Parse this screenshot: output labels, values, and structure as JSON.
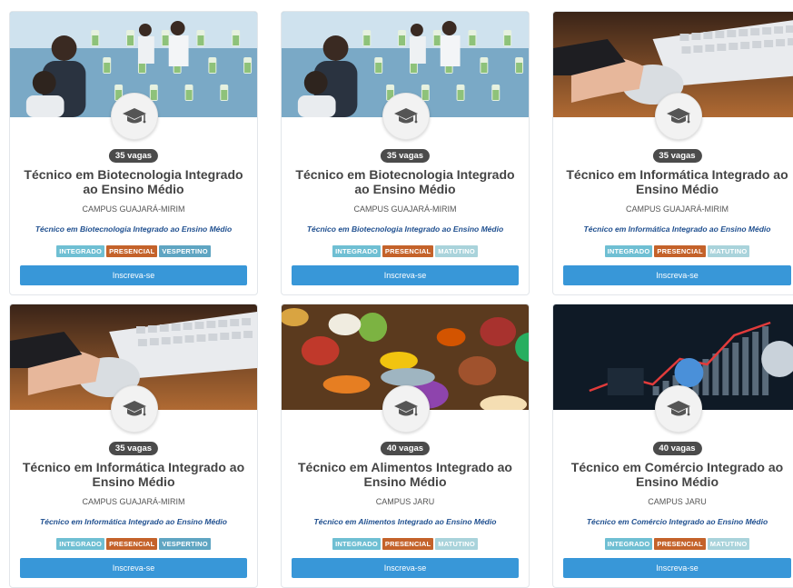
{
  "colors": {
    "tag_integrado": "#6fbfd3",
    "tag_presencial": "#c4622a",
    "tag_vespertino": "#5fa5c2",
    "tag_matutino": "#a9d3db",
    "button": "#3897d8",
    "vagas_badge": "#4b4b4b",
    "description": "#1f4f8f"
  },
  "cards": [
    {
      "image": "biotech-lab-photo",
      "vagas": "35 vagas",
      "title": "Técnico em Biotecnologia Integrado ao Ensino Médio",
      "campus": "CAMPUS GUAJARÁ-MIRIM",
      "description": "Técnico em Biotecnologia Integrado ao Ensino Médio",
      "tags": [
        "INTEGRADO",
        "PRESENCIAL",
        "VESPERTINO"
      ],
      "button": "Inscreva-se"
    },
    {
      "image": "biotech-lab-photo",
      "vagas": "35 vagas",
      "title": "Técnico em Biotecnologia Integrado ao Ensino Médio",
      "campus": "CAMPUS GUAJARÁ-MIRIM",
      "description": "Técnico em Biotecnologia Integrado ao Ensino Médio",
      "tags": [
        "INTEGRADO",
        "PRESENCIAL",
        "MATUTINO"
      ],
      "button": "Inscreva-se"
    },
    {
      "image": "computer-mouse-photo",
      "vagas": "35 vagas",
      "title": "Técnico em Informática Integrado ao Ensino Médio",
      "campus": "CAMPUS GUAJARÁ-MIRIM",
      "description": "Técnico em Informática Integrado ao Ensino Médio",
      "tags": [
        "INTEGRADO",
        "PRESENCIAL",
        "MATUTINO"
      ],
      "button": "Inscreva-se"
    },
    {
      "image": "computer-mouse-photo",
      "vagas": "35 vagas",
      "title": "Técnico em Informática Integrado ao Ensino Médio",
      "campus": "CAMPUS GUAJARÁ-MIRIM",
      "description": "Técnico em Informática Integrado ao Ensino Médio",
      "tags": [
        "INTEGRADO",
        "PRESENCIAL",
        "VESPERTINO"
      ],
      "button": "Inscreva-se"
    },
    {
      "image": "food-photo",
      "vagas": "40 vagas",
      "title": "Técnico em Alimentos Integrado ao Ensino Médio",
      "campus": "CAMPUS JARU",
      "description": "Técnico em Alimentos Integrado ao Ensino Médio",
      "tags": [
        "INTEGRADO",
        "PRESENCIAL",
        "MATUTINO"
      ],
      "button": "Inscreva-se"
    },
    {
      "image": "business-chart-photo",
      "vagas": "40 vagas",
      "title": "Técnico em Comércio Integrado ao Ensino Médio",
      "campus": "CAMPUS JARU",
      "description": "Técnico em Comércio Integrado ao Ensino Médio",
      "tags": [
        "INTEGRADO",
        "PRESENCIAL",
        "MATUTINO"
      ],
      "button": "Inscreva-se"
    }
  ]
}
